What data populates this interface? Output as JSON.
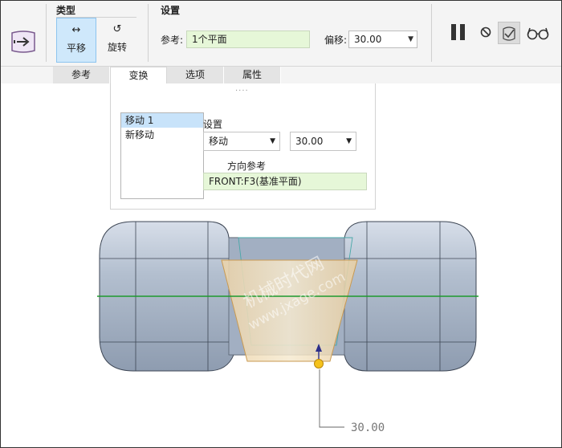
{
  "ribbon": {
    "type_group": {
      "title": "类型",
      "buttons": [
        {
          "label": "平移",
          "glyph": "↔",
          "active": true
        },
        {
          "label": "旋转",
          "glyph": "↺",
          "active": false
        }
      ]
    },
    "settings_group": {
      "title": "设置",
      "reference_label": "参考:",
      "reference_value": "1个平面",
      "offset_label": "偏移:",
      "offset_value": "30.00"
    },
    "tools": [
      "pause-icon",
      "no-icon",
      "check-preview-icon",
      "glasses-icon"
    ]
  },
  "tabs": [
    {
      "label": "参考",
      "active": false
    },
    {
      "label": "变换",
      "active": true
    },
    {
      "label": "选项",
      "active": false
    },
    {
      "label": "属性",
      "active": false
    }
  ],
  "transform_panel": {
    "grip": "····",
    "moves": [
      {
        "label": "移动 1",
        "selected": true
      },
      {
        "label": "新移动",
        "selected": false
      }
    ],
    "settings_label": "设置",
    "mode_value": "移动",
    "distance_value": "30.00",
    "direction_label": "方向参考",
    "direction_value": "FRONT:F3(基准平面)"
  },
  "viewport": {
    "dimension_text": "30.00",
    "watermark_line1": "机械时代网",
    "watermark_line2": "www.jxage.com",
    "colors": {
      "part_fill": "#a9b6c8",
      "trapezoid_fill": "#f0dcb4",
      "axis_line": "#1e9a2e",
      "handle": "#f5c21b"
    }
  }
}
